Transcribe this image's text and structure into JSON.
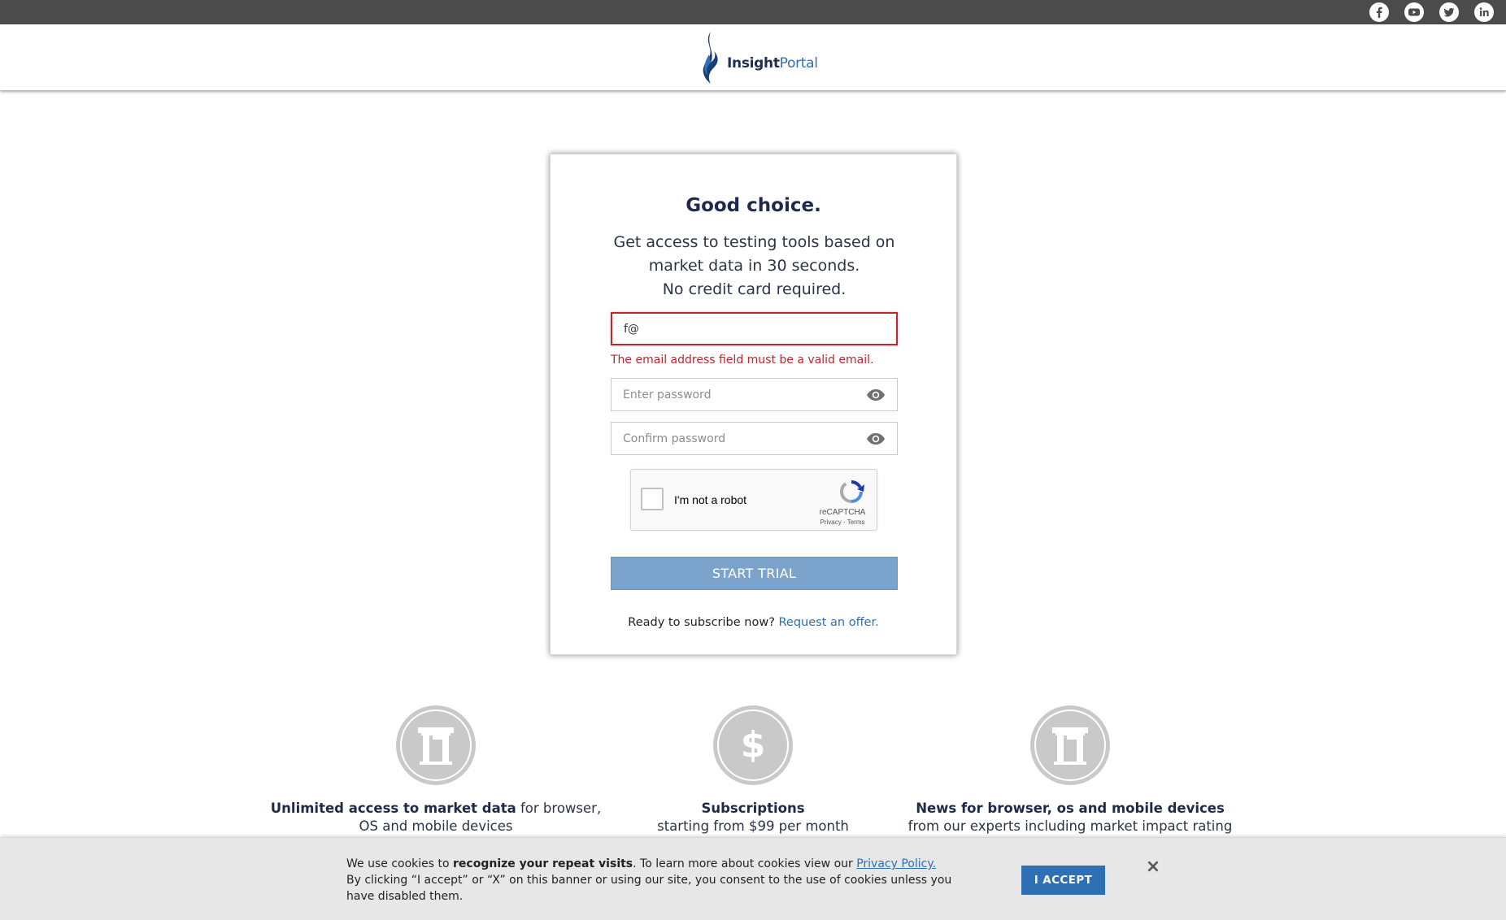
{
  "social": {
    "icons": [
      "facebook-icon",
      "youtube-icon",
      "twitter-icon",
      "linkedin-icon"
    ]
  },
  "header": {
    "logo_text_bold": "Insight",
    "logo_text_light": "Portal"
  },
  "card": {
    "title": "Good choice.",
    "subtitle_line1": "Get access to testing tools based on",
    "subtitle_line2": "market data in 30 seconds.",
    "subtitle_line3": "No credit card required.",
    "email_value": "f@",
    "email_error": "The email address field must be a valid email.",
    "password_placeholder": "Enter password",
    "confirm_placeholder": "Confirm password",
    "captcha_label": "I'm not a robot",
    "captcha_brand": "reCAPTCHA",
    "captcha_links": "Privacy - Terms",
    "start_button": "START TRIAL",
    "subscribe_text": "Ready to subscribe now?",
    "subscribe_link": "Request an offer."
  },
  "features": [
    {
      "bold": "Unlimited access to market data",
      "rest": " for browser,",
      "line2": "OS and mobile devices",
      "icon": "building-icon"
    },
    {
      "bold": "Subscriptions",
      "rest": "",
      "line2": "starting from $99 per month",
      "icon": "dollar-icon"
    },
    {
      "bold": "News for browser, os and mobile devices",
      "rest": "",
      "line2": "from our experts including market impact rating",
      "icon": "building-icon"
    }
  ],
  "cookie": {
    "text_before": "We use cookies to ",
    "text_bold": "recognize your repeat visits",
    "text_after": ". To learn more about cookies view our ",
    "privacy_link": "Privacy Policy.",
    "text_line2": "By clicking “I accept” or “X” on this banner or using our site, you consent to the use of cookies unless you have disabled them.",
    "accept_button": "I ACCEPT",
    "close_label": "×"
  },
  "colors": {
    "accent": "#2f6fb3",
    "error": "#b9282f",
    "start_button": "#7ca3cc",
    "topbar": "#4b4b4b"
  }
}
